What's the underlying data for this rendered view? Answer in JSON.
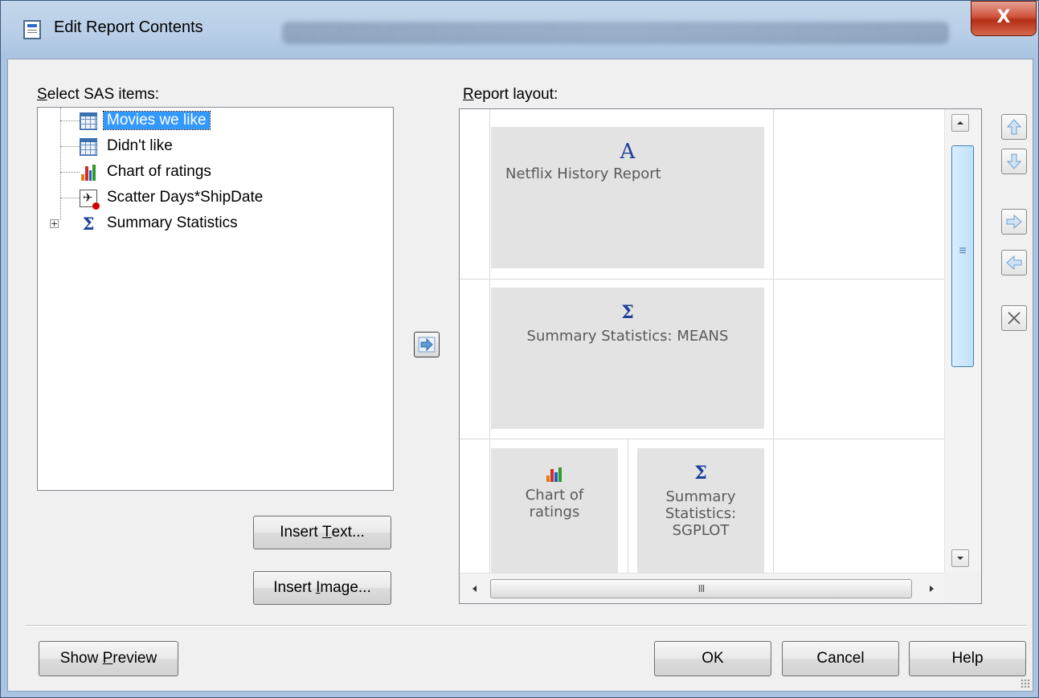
{
  "window": {
    "title": "Edit Report Contents",
    "close_symbol": "X"
  },
  "left_panel": {
    "label_prefix": "S",
    "label_rest": "elect SAS items:",
    "tree_items": [
      {
        "label": "Movies we like",
        "icon": "table-grid-icon",
        "selected": true
      },
      {
        "label": "Didn't like",
        "icon": "table-grid-icon",
        "selected": false
      },
      {
        "label": "Chart of ratings",
        "icon": "bar-chart-icon",
        "selected": false
      },
      {
        "label": "Scatter Days*ShipDate",
        "icon": "scatter-plot-icon",
        "selected": false
      },
      {
        "label": "Summary Statistics",
        "icon": "sigma-icon",
        "selected": false,
        "expandable": true,
        "expander": "+"
      }
    ],
    "insert_text_button": {
      "prefix": "Insert ",
      "mnemonic": "T",
      "rest": "ext..."
    },
    "insert_image_button": {
      "prefix": "Insert ",
      "mnemonic": "I",
      "rest": "mage..."
    }
  },
  "add_button": {
    "icon": "arrow-right-icon"
  },
  "right_panel": {
    "label_prefix": "R",
    "label_rest": "eport layout:",
    "cells": [
      {
        "icon_text": "A",
        "label": "Netflix History Report"
      },
      {
        "icon_text": "Σ",
        "label": "Summary Statistics:  MEANS"
      },
      {
        "icon_text": "",
        "label_line1": "Chart of",
        "label_line2": "ratings"
      },
      {
        "icon_text": "Σ",
        "label_line1": "Summary",
        "label_line2": "Statistics:",
        "label_line3": "SGPLOT"
      }
    ],
    "scroll_thumb_grip": "≡",
    "hscroll_grip": "III"
  },
  "side_buttons": [
    "arrow-up-icon",
    "arrow-down-icon",
    "arrow-right-icon",
    "arrow-left-icon",
    "remove-x-icon"
  ],
  "footer": {
    "show_preview": {
      "prefix": "Show ",
      "mnemonic": "P",
      "rest": "review"
    },
    "ok": "OK",
    "cancel": "Cancel",
    "help": "Help"
  },
  "colors": {
    "selection": "#3399ff",
    "sigma_blue": "#1d3f9a",
    "close_red": "#c8422a"
  }
}
